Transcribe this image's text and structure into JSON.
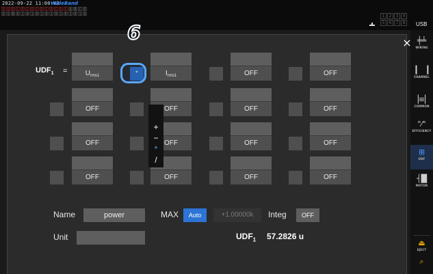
{
  "status": {
    "timestamp": "2022-09-22 11:00:43",
    "mode_badge": "WideBand",
    "channel_row1": [
      "U",
      "U",
      "D",
      "C",
      "D",
      "C",
      "D",
      "C",
      "D",
      "C",
      "D",
      "C",
      "D",
      "C",
      "A",
      "B",
      "C",
      "D"
    ],
    "channel_row2": [
      "U",
      "S",
      "B",
      "0",
      "1",
      "0",
      "1",
      "0",
      "1",
      "0",
      "1",
      "0",
      "1",
      "0",
      "1",
      "0",
      "1",
      "0"
    ],
    "channel_grid": [
      "1",
      "2",
      "3",
      "4",
      "5",
      "6",
      "7",
      "8"
    ],
    "usb_label": "USB"
  },
  "step_marker": "6",
  "formula": {
    "label": "UDF",
    "label_sub": "1",
    "equals": "=",
    "rows": [
      [
        {
          "type": "cell",
          "name": "U",
          "sub": "rms1"
        },
        {
          "type": "op",
          "value": "*"
        },
        {
          "type": "cell",
          "name": "I",
          "sub": "rms1"
        },
        {
          "type": "op",
          "value": ""
        },
        {
          "type": "cell",
          "name": "OFF",
          "sub": ""
        },
        {
          "type": "op",
          "value": ""
        },
        {
          "type": "cell",
          "name": "OFF",
          "sub": ""
        }
      ],
      [
        {
          "type": "op",
          "value": ""
        },
        {
          "type": "cell",
          "name": "OFF",
          "sub": ""
        },
        {
          "type": "op",
          "value": ""
        },
        {
          "type": "cell",
          "name": "OFF",
          "sub": ""
        },
        {
          "type": "op",
          "value": ""
        },
        {
          "type": "cell",
          "name": "OFF",
          "sub": ""
        },
        {
          "type": "op",
          "value": ""
        },
        {
          "type": "cell",
          "name": "OFF",
          "sub": ""
        }
      ],
      [
        {
          "type": "op",
          "value": ""
        },
        {
          "type": "cell",
          "name": "OFF",
          "sub": ""
        },
        {
          "type": "op",
          "value": ""
        },
        {
          "type": "cell",
          "name": "OFF",
          "sub": ""
        },
        {
          "type": "op",
          "value": ""
        },
        {
          "type": "cell",
          "name": "OFF",
          "sub": ""
        },
        {
          "type": "op",
          "value": ""
        },
        {
          "type": "cell",
          "name": "OFF",
          "sub": ""
        }
      ],
      [
        {
          "type": "op",
          "value": ""
        },
        {
          "type": "cell",
          "name": "OFF",
          "sub": ""
        },
        {
          "type": "op",
          "value": ""
        },
        {
          "type": "cell",
          "name": "OFF",
          "sub": ""
        },
        {
          "type": "op",
          "value": ""
        },
        {
          "type": "cell",
          "name": "OFF",
          "sub": ""
        },
        {
          "type": "op",
          "value": ""
        },
        {
          "type": "cell",
          "name": "OFF",
          "sub": ""
        }
      ]
    ]
  },
  "operator_popup": {
    "options": [
      "+",
      "−",
      "*",
      "/"
    ],
    "selected_index": 2
  },
  "form": {
    "name_label": "Name",
    "name_value": "power",
    "max_label": "MAX",
    "max_mode": "Auto",
    "max_value": "+1.00000k",
    "integ_label": "Integ",
    "integ_value": "OFF",
    "unit_label": "Unit",
    "unit_value": ""
  },
  "result": {
    "label": "UDF",
    "label_sub": "1",
    "value": "57.2826 u"
  },
  "sidebar": {
    "items": [
      {
        "label": "WIRING",
        "icon": "wiring-icon",
        "glyph": "╪╧"
      },
      {
        "label": "CHANNEL",
        "icon": "channel-icon",
        "glyph": "▕▏▕▏"
      },
      {
        "label": "COMMON",
        "icon": "common-icon",
        "glyph": "▕≡▏"
      },
      {
        "label": "EFFICIENCY",
        "icon": "efficiency-icon",
        "glyph": "°⁄°"
      },
      {
        "label": "UDF",
        "icon": "udf-icon",
        "glyph": "⊞"
      },
      {
        "label": "MOTOR",
        "icon": "motor-icon",
        "glyph": "┤█"
      }
    ],
    "active": "UDF",
    "eject_label": "EJECT",
    "accent_color": "#2c74d6"
  },
  "colors": {
    "accent_blue": "#2c74d6",
    "marker_outline": "#5aa8ff",
    "eject_yellow": "#e6a700"
  }
}
